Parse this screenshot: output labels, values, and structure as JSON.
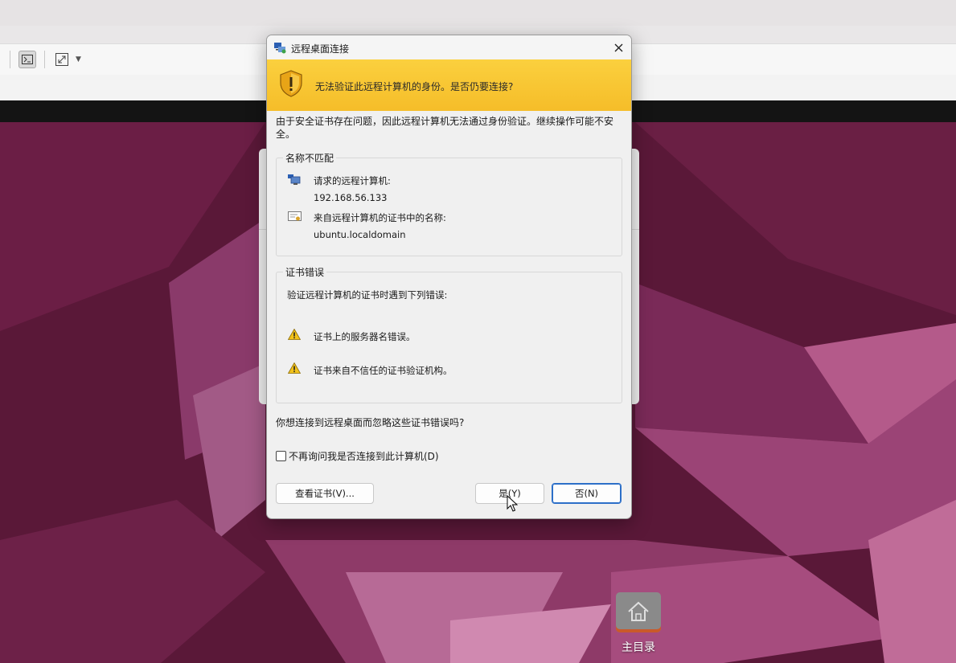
{
  "dialog": {
    "title": "远程桌面连接",
    "banner_text": "无法验证此远程计算机的身份。是否仍要连接?",
    "intro": "由于安全证书存在问题，因此远程计算机无法通过身份验证。继续操作可能不安全。",
    "name_group": {
      "legend": "名称不匹配",
      "requested_label": "请求的远程计算机:",
      "requested_value": "192.168.56.133",
      "cert_label": "来自远程计算机的证书中的名称:",
      "cert_value": "ubuntu.localdomain"
    },
    "cert_group": {
      "legend": "证书错误",
      "intro": "验证远程计算机的证书时遇到下列错误:",
      "errors": [
        "证书上的服务器名错误。",
        "证书来自不信任的证书验证机构。"
      ]
    },
    "question": "你想连接到远程桌面而忽略这些证书错误吗?",
    "checkbox_label": "不再询问我是否连接到此计算机(D)",
    "checkbox_checked": false,
    "buttons": {
      "view_cert": "查看证书(V)...",
      "yes": "是(Y)",
      "no": "否(N)"
    }
  },
  "desktop": {
    "home_folder_label": "主目录"
  },
  "icons": {
    "toolbar": [
      "terminal-icon",
      "fullscreen-icon",
      "chevron-down-icon"
    ],
    "dialog": [
      "remote-desktop-icon",
      "close-icon",
      "shield-warning-icon",
      "computer-icon",
      "certificate-icon",
      "warning-icon"
    ],
    "desktop": [
      "home-icon"
    ]
  },
  "colors": {
    "banner": "#f5bd29",
    "desktop_bg": "#5e1b3c",
    "default_button_border": "#2c6fc8"
  }
}
